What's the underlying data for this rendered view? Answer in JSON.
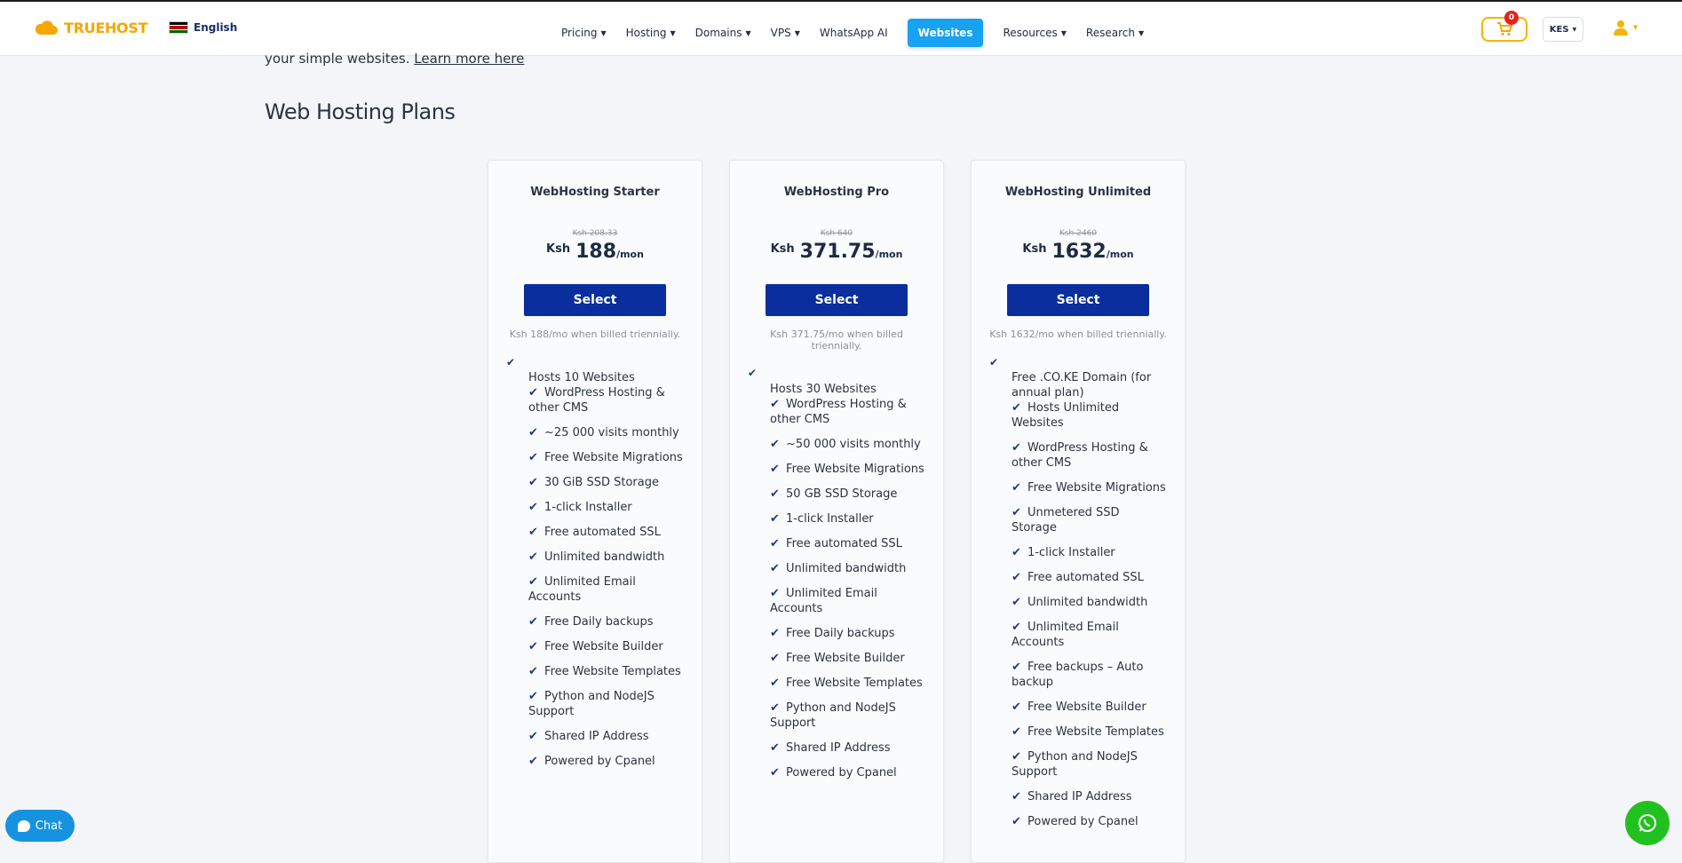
{
  "brand": {
    "name": "TRUEHOST",
    "accent": "#f6a600"
  },
  "language": {
    "label": "English",
    "flag": "kenya-flag"
  },
  "nav": {
    "items": [
      "Pricing",
      "Hosting",
      "Domains",
      "VPS",
      "WhatsApp AI"
    ],
    "active": "Websites",
    "after": [
      "Resources",
      "Research"
    ]
  },
  "cart": {
    "count": "0"
  },
  "currency": {
    "code": "KES"
  },
  "intro": {
    "text": "your simple websites. ",
    "link": "Learn more here"
  },
  "section_title": "Web Hosting Plans",
  "plans": [
    {
      "name": "WebHosting Starter",
      "old_price": "Ksh 208.33",
      "currency": "Ksh",
      "price": "188",
      "per": "/mon",
      "select_label": "Select",
      "billing_note": "Ksh 188/mo when billed triennially.",
      "features": [
        "Hosts 10 Websites",
        "✔ WordPress Hosting & other CMS",
        "✔  ~25 000 visits monthly",
        "✔ Free Website Migrations",
        "✔ 30 GiB SSD Storage",
        "✔ 1-click Installer",
        "✔ Free automated SSL",
        "✔ Unlimited bandwidth",
        "✔ Unlimited Email Accounts",
        "✔ Free Daily backups",
        "✔ Free Website Builder",
        "✔ Free Website Templates",
        "✔ Python and NodeJS Support",
        "✔ Shared IP Address",
        "✔ Powered by Cpanel"
      ]
    },
    {
      "name": "WebHosting Pro",
      "old_price": "Ksh 640",
      "currency": "Ksh",
      "price": "371.75",
      "per": "/mon",
      "select_label": "Select",
      "billing_note": "Ksh 371.75/mo when billed triennially.",
      "features": [
        "Hosts 30 Websites",
        "✔ WordPress Hosting & other CMS",
        "✔ ~50 000 visits monthly",
        "✔ Free Website Migrations",
        "✔ 50 GB SSD Storage",
        "✔ 1-click Installer",
        "✔ Free automated SSL",
        "✔ Unlimited bandwidth",
        "✔ Unlimited Email Accounts",
        "✔ Free Daily backups",
        "✔ Free Website Builder",
        "✔ Free Website Templates",
        "✔ Python and NodeJS Support",
        "✔ Shared IP Address",
        "✔ Powered by Cpanel"
      ]
    },
    {
      "name": "WebHosting Unlimited",
      "old_price": "Ksh 2460",
      "currency": "Ksh",
      "price": "1632",
      "per": "/mon",
      "select_label": "Select",
      "billing_note": "Ksh 1632/mo when billed triennially.",
      "features": [
        "Free .CO.KE Domain (for annual plan)",
        "✔ Hosts Unlimited Websites",
        "✔ WordPress Hosting & other CMS",
        "✔ Free Website Migrations",
        "✔ Unmetered SSD Storage",
        "✔ 1-click Installer",
        "✔ Free automated SSL",
        "✔ Unlimited bandwidth",
        "✔ Unlimited Email Accounts",
        "✔ Free backups – Auto backup",
        "✔ Free Website Builder",
        "✔ Free Website Templates",
        "✔ Python and NodeJS Support",
        "✔ Shared IP Address",
        "✔ Powered by Cpanel"
      ]
    }
  ],
  "chat": {
    "label": "Chat"
  },
  "colors": {
    "primary_button": "#0a2e9d",
    "nav_active": "#17a2f2",
    "whatsapp": "#21c21f",
    "chat": "#1693e0"
  }
}
